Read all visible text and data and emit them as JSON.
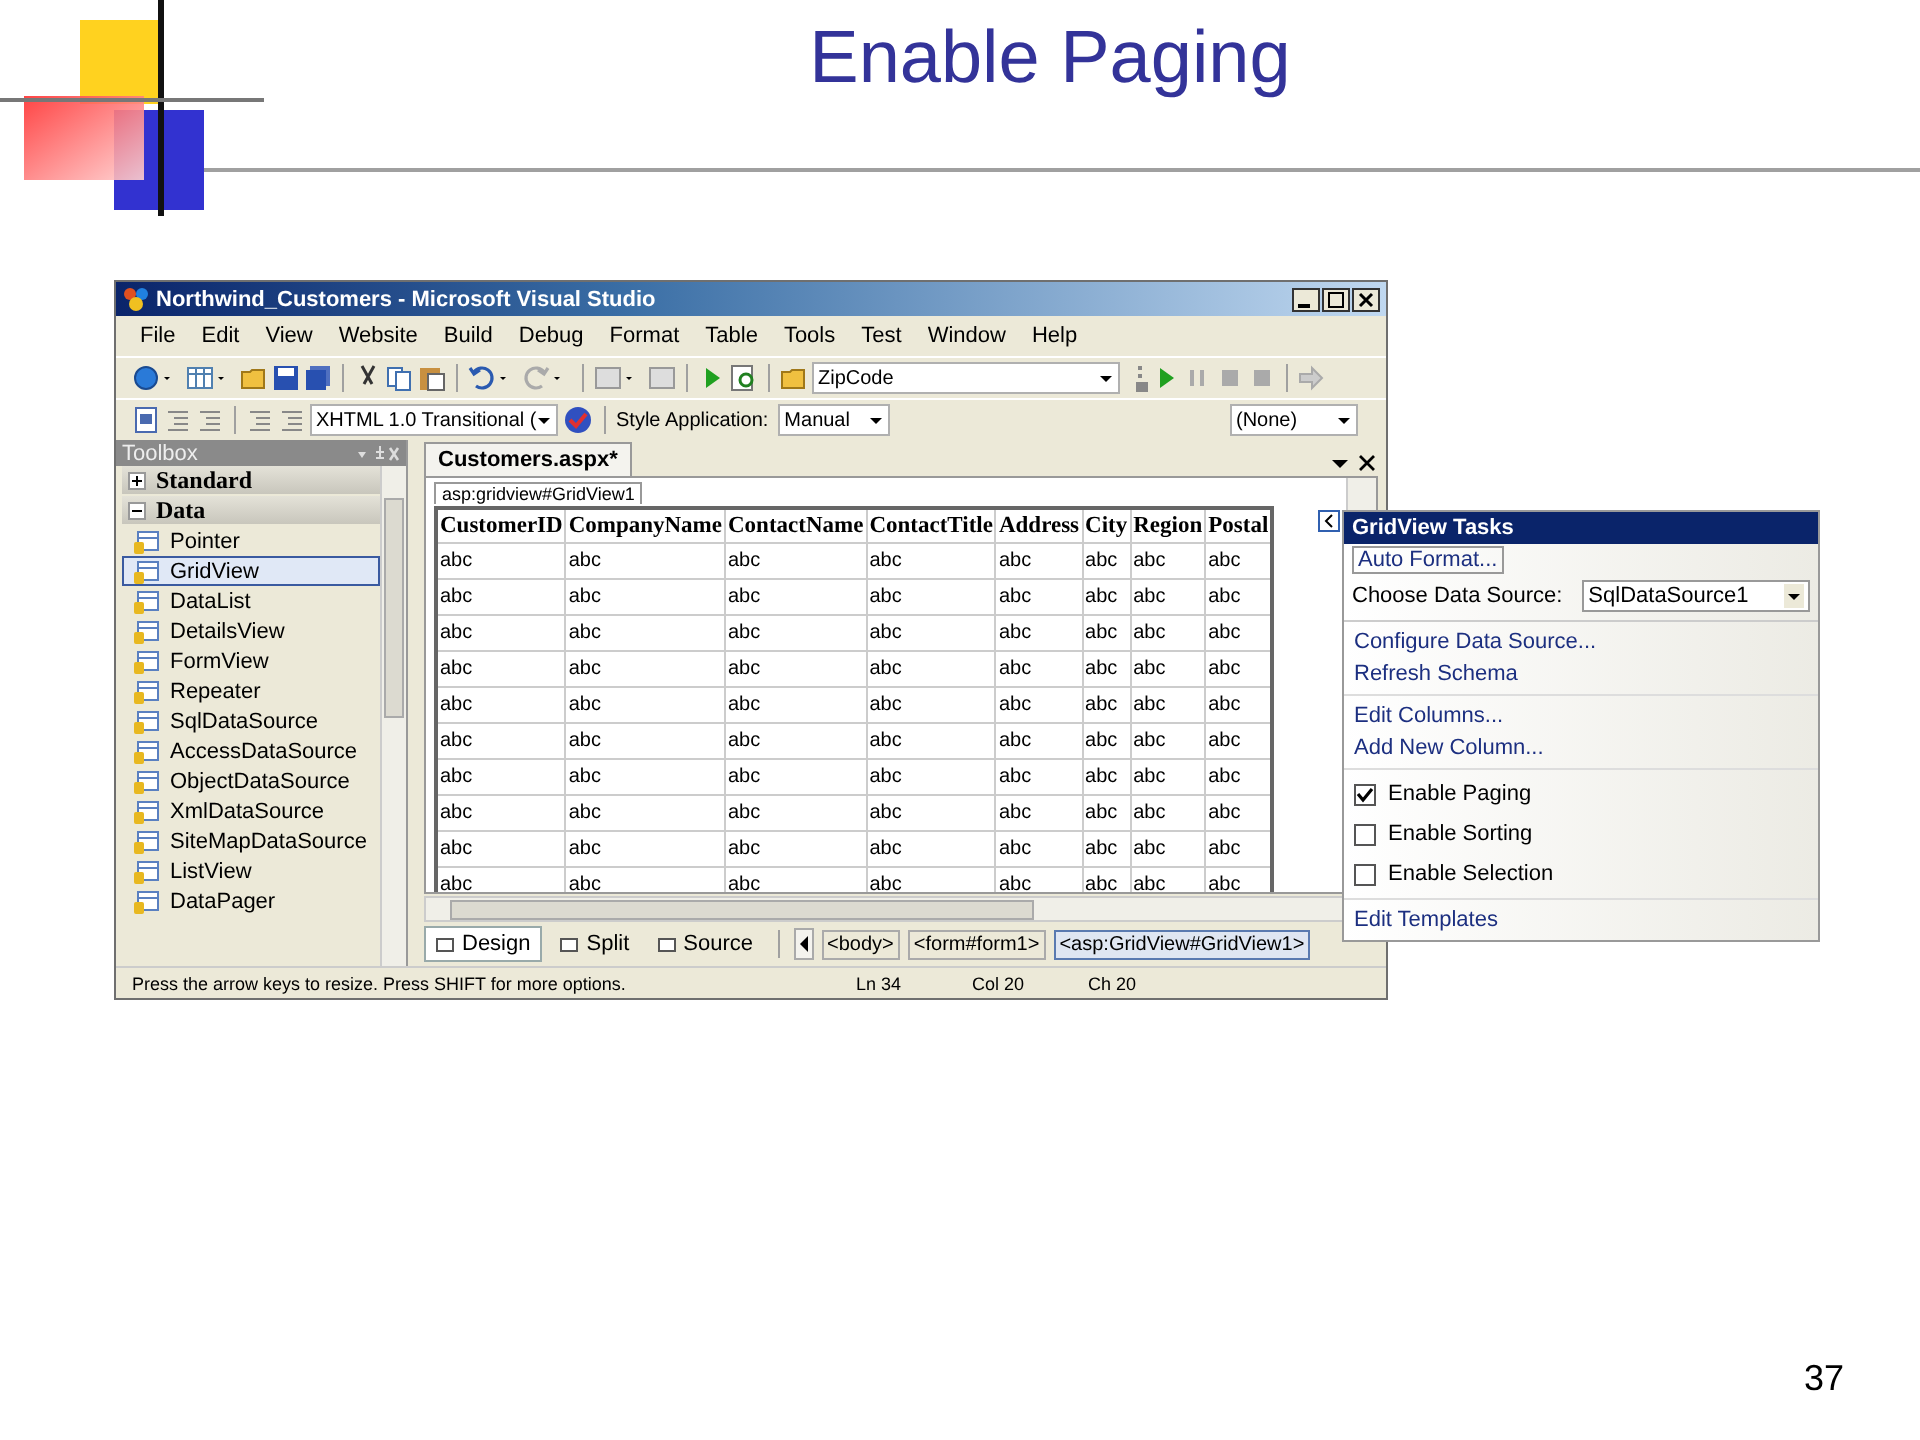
{
  "slide": {
    "title": "Enable Paging",
    "page_number": "37"
  },
  "window": {
    "title": "Northwind_Customers - Microsoft Visual Studio",
    "menu": [
      "File",
      "Edit",
      "View",
      "Website",
      "Build",
      "Debug",
      "Format",
      "Table",
      "Tools",
      "Test",
      "Window",
      "Help"
    ],
    "toolbar": {
      "object_combo": "ZipCode",
      "doc_type": "XHTML 1.0 Transitional (",
      "style_label": "Style Application:",
      "style_value": "Manual",
      "target_value": "(None)"
    }
  },
  "toolbox": {
    "title": "Toolbox",
    "groups": [
      {
        "label": "Standard",
        "expanded": false
      },
      {
        "label": "Data",
        "expanded": true,
        "items": [
          {
            "label": "Pointer",
            "selected": false
          },
          {
            "label": "GridView",
            "selected": true
          },
          {
            "label": "DataList",
            "selected": false
          },
          {
            "label": "DetailsView",
            "selected": false
          },
          {
            "label": "FormView",
            "selected": false
          },
          {
            "label": "Repeater",
            "selected": false
          },
          {
            "label": "SqlDataSource",
            "selected": false
          },
          {
            "label": "AccessDataSource",
            "selected": false
          },
          {
            "label": "ObjectDataSource",
            "selected": false
          },
          {
            "label": "XmlDataSource",
            "selected": false
          },
          {
            "label": "SiteMapDataSource",
            "selected": false
          },
          {
            "label": "ListView",
            "selected": false
          },
          {
            "label": "DataPager",
            "selected": false
          }
        ]
      }
    ]
  },
  "editor": {
    "tab": "Customers.aspx*",
    "element_tag": "asp:gridview#GridView1",
    "columns": [
      "CustomerID",
      "CompanyName",
      "ContactName",
      "ContactTitle",
      "Address",
      "City",
      "Region",
      "Postal"
    ],
    "rows": [
      [
        "abc",
        "abc",
        "abc",
        "abc",
        "abc",
        "abc",
        "abc",
        "abc"
      ],
      [
        "abc",
        "abc",
        "abc",
        "abc",
        "abc",
        "abc",
        "abc",
        "abc"
      ],
      [
        "abc",
        "abc",
        "abc",
        "abc",
        "abc",
        "abc",
        "abc",
        "abc"
      ],
      [
        "abc",
        "abc",
        "abc",
        "abc",
        "abc",
        "abc",
        "abc",
        "abc"
      ],
      [
        "abc",
        "abc",
        "abc",
        "abc",
        "abc",
        "abc",
        "abc",
        "abc"
      ],
      [
        "abc",
        "abc",
        "abc",
        "abc",
        "abc",
        "abc",
        "abc",
        "abc"
      ],
      [
        "abc",
        "abc",
        "abc",
        "abc",
        "abc",
        "abc",
        "abc",
        "abc"
      ],
      [
        "abc",
        "abc",
        "abc",
        "abc",
        "abc",
        "abc",
        "abc",
        "abc"
      ],
      [
        "abc",
        "abc",
        "abc",
        "abc",
        "abc",
        "abc",
        "abc",
        "abc"
      ],
      [
        "abc",
        "abc",
        "abc",
        "abc",
        "abc",
        "abc",
        "abc",
        "abc"
      ]
    ],
    "views": [
      {
        "label": "Design",
        "selected": true
      },
      {
        "label": "Split",
        "selected": false
      },
      {
        "label": "Source",
        "selected": false
      }
    ],
    "breadcrumb": [
      {
        "label": "<body>",
        "selected": false
      },
      {
        "label": "<form#form1>",
        "selected": false
      },
      {
        "label": "<asp:GridView#GridView1>",
        "selected": true
      }
    ]
  },
  "status_bar": {
    "message": "Press the arrow keys to resize. Press SHIFT for more options.",
    "line": "Ln 34",
    "column": "Col 20",
    "character": "Ch 20"
  },
  "tasks": {
    "title": "GridView Tasks",
    "auto_format": "Auto Format...",
    "data_source_label": "Choose Data Source:",
    "data_source_value": "SqlDataSource1",
    "links_top": [
      "Configure Data Source...",
      "Refresh Schema"
    ],
    "links_mid": [
      "Edit Columns...",
      "Add New Column..."
    ],
    "options": [
      {
        "label": "Enable Paging",
        "checked": true
      },
      {
        "label": "Enable Sorting",
        "checked": false
      },
      {
        "label": "Enable Selection",
        "checked": false
      }
    ],
    "footer_link": "Edit Templates"
  }
}
